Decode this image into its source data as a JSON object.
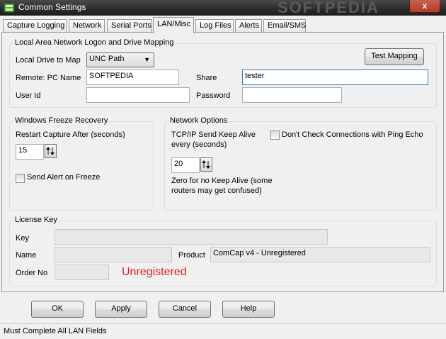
{
  "window": {
    "title": "Common Settings",
    "watermark": "SOFTPEDIA",
    "close_glyph": "x"
  },
  "tabs": [
    {
      "label": "Capture Logging"
    },
    {
      "label": "Network"
    },
    {
      "label": "Serial Ports"
    },
    {
      "label": "LAN/Misc"
    },
    {
      "label": "Log Files"
    },
    {
      "label": "Alerts"
    },
    {
      "label": "Email/SMS"
    }
  ],
  "active_tab": "LAN/Misc",
  "lan_group": {
    "title": "Local Area Network Logon and Drive Mapping",
    "drive_label": "Local Drive to Map",
    "drive_value": "UNC Path",
    "test_button": "Test Mapping",
    "remote_pc_label": "Remote: PC Name",
    "remote_pc_value": "SOFTPEDIA",
    "share_label": "Share",
    "share_value": "tester",
    "user_label": "User Id",
    "user_value": "",
    "password_label": "Password",
    "password_value": ""
  },
  "freeze_group": {
    "title": "Windows Freeze Recovery",
    "restart_label": "Restart Capture After (seconds)",
    "restart_value": "15",
    "send_alert_label": "Send Alert on Freeze",
    "send_alert_checked": false
  },
  "network_group": {
    "title": "Network Options",
    "keepalive_label_1": "TCP/IP Send Keep Alive",
    "keepalive_label_2": "every (seconds)",
    "keepalive_value": "20",
    "zero_note_1": "Zero for no Keep Alive (some",
    "zero_note_2": "routers may get confused)",
    "ping_label": "Don't Check Connections with Ping Echo",
    "ping_checked": false
  },
  "license_group": {
    "title": "License Key",
    "key_label": "Key",
    "key_value": "",
    "name_label": "Name",
    "name_value": "",
    "product_label": "Product",
    "product_value": "ComCap v4 - Unregistered",
    "order_label": "Order No",
    "order_value": "",
    "status_text": "Unregistered",
    "status_color": "#e02020"
  },
  "buttons": {
    "ok": "OK",
    "apply": "Apply",
    "cancel": "Cancel",
    "help": "Help"
  },
  "statusbar": {
    "text": "Must Complete All LAN Fields"
  }
}
